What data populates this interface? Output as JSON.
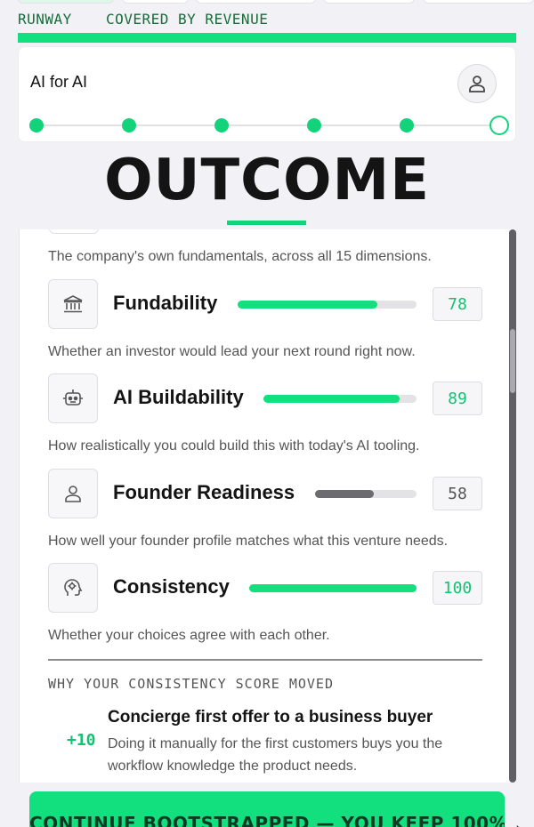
{
  "strip": {
    "items": [
      "RUNWAY",
      "COVERED BY REVENUE"
    ]
  },
  "header": {
    "project_name": "AI for AI",
    "stepper": {
      "total_steps": 6,
      "completed_steps": 5
    }
  },
  "page_title": "OUTCOME",
  "intro_description": "The company's own fundamentals, across all 15 dimensions.",
  "metrics": [
    {
      "label": "Fundability",
      "score": "78",
      "fill": 0.78,
      "bar_color": "#12e07f",
      "score_color": "#12c272",
      "icon": "bank-icon",
      "description": "Whether an investor would lead your next round right now."
    },
    {
      "label": "AI Buildability",
      "score": "89",
      "fill": 0.89,
      "bar_color": "#12e07f",
      "score_color": "#12c272",
      "icon": "robot-icon",
      "description": "How realistically you could build this with today's AI tooling."
    },
    {
      "label": "Founder Readiness",
      "score": "58",
      "fill": 0.58,
      "bar_color": "#6b6b70",
      "score_color": "#555555",
      "icon": "person-icon",
      "description": "How well your founder profile matches what this venture needs."
    },
    {
      "label": "Consistency",
      "score": "100",
      "fill": 1.0,
      "bar_color": "#12e07f",
      "score_color": "#12c272",
      "icon": "head-gear-icon",
      "description": "Whether your choices agree with each other."
    }
  ],
  "why_section": {
    "heading": "WHY YOUR CONSISTENCY SCORE MOVED",
    "change": {
      "delta": "+10",
      "title": "Concierge first offer to a business buyer",
      "description": "Doing it manually for the first customers buys you the workflow knowledge the product needs."
    }
  },
  "cta": {
    "label": "CONTINUE BOOTSTRAPPED — YOU KEEP 100%",
    "arrow": "→"
  },
  "colors": {
    "accent": "#12e07f",
    "neutral_bar": "#6b6b70"
  }
}
